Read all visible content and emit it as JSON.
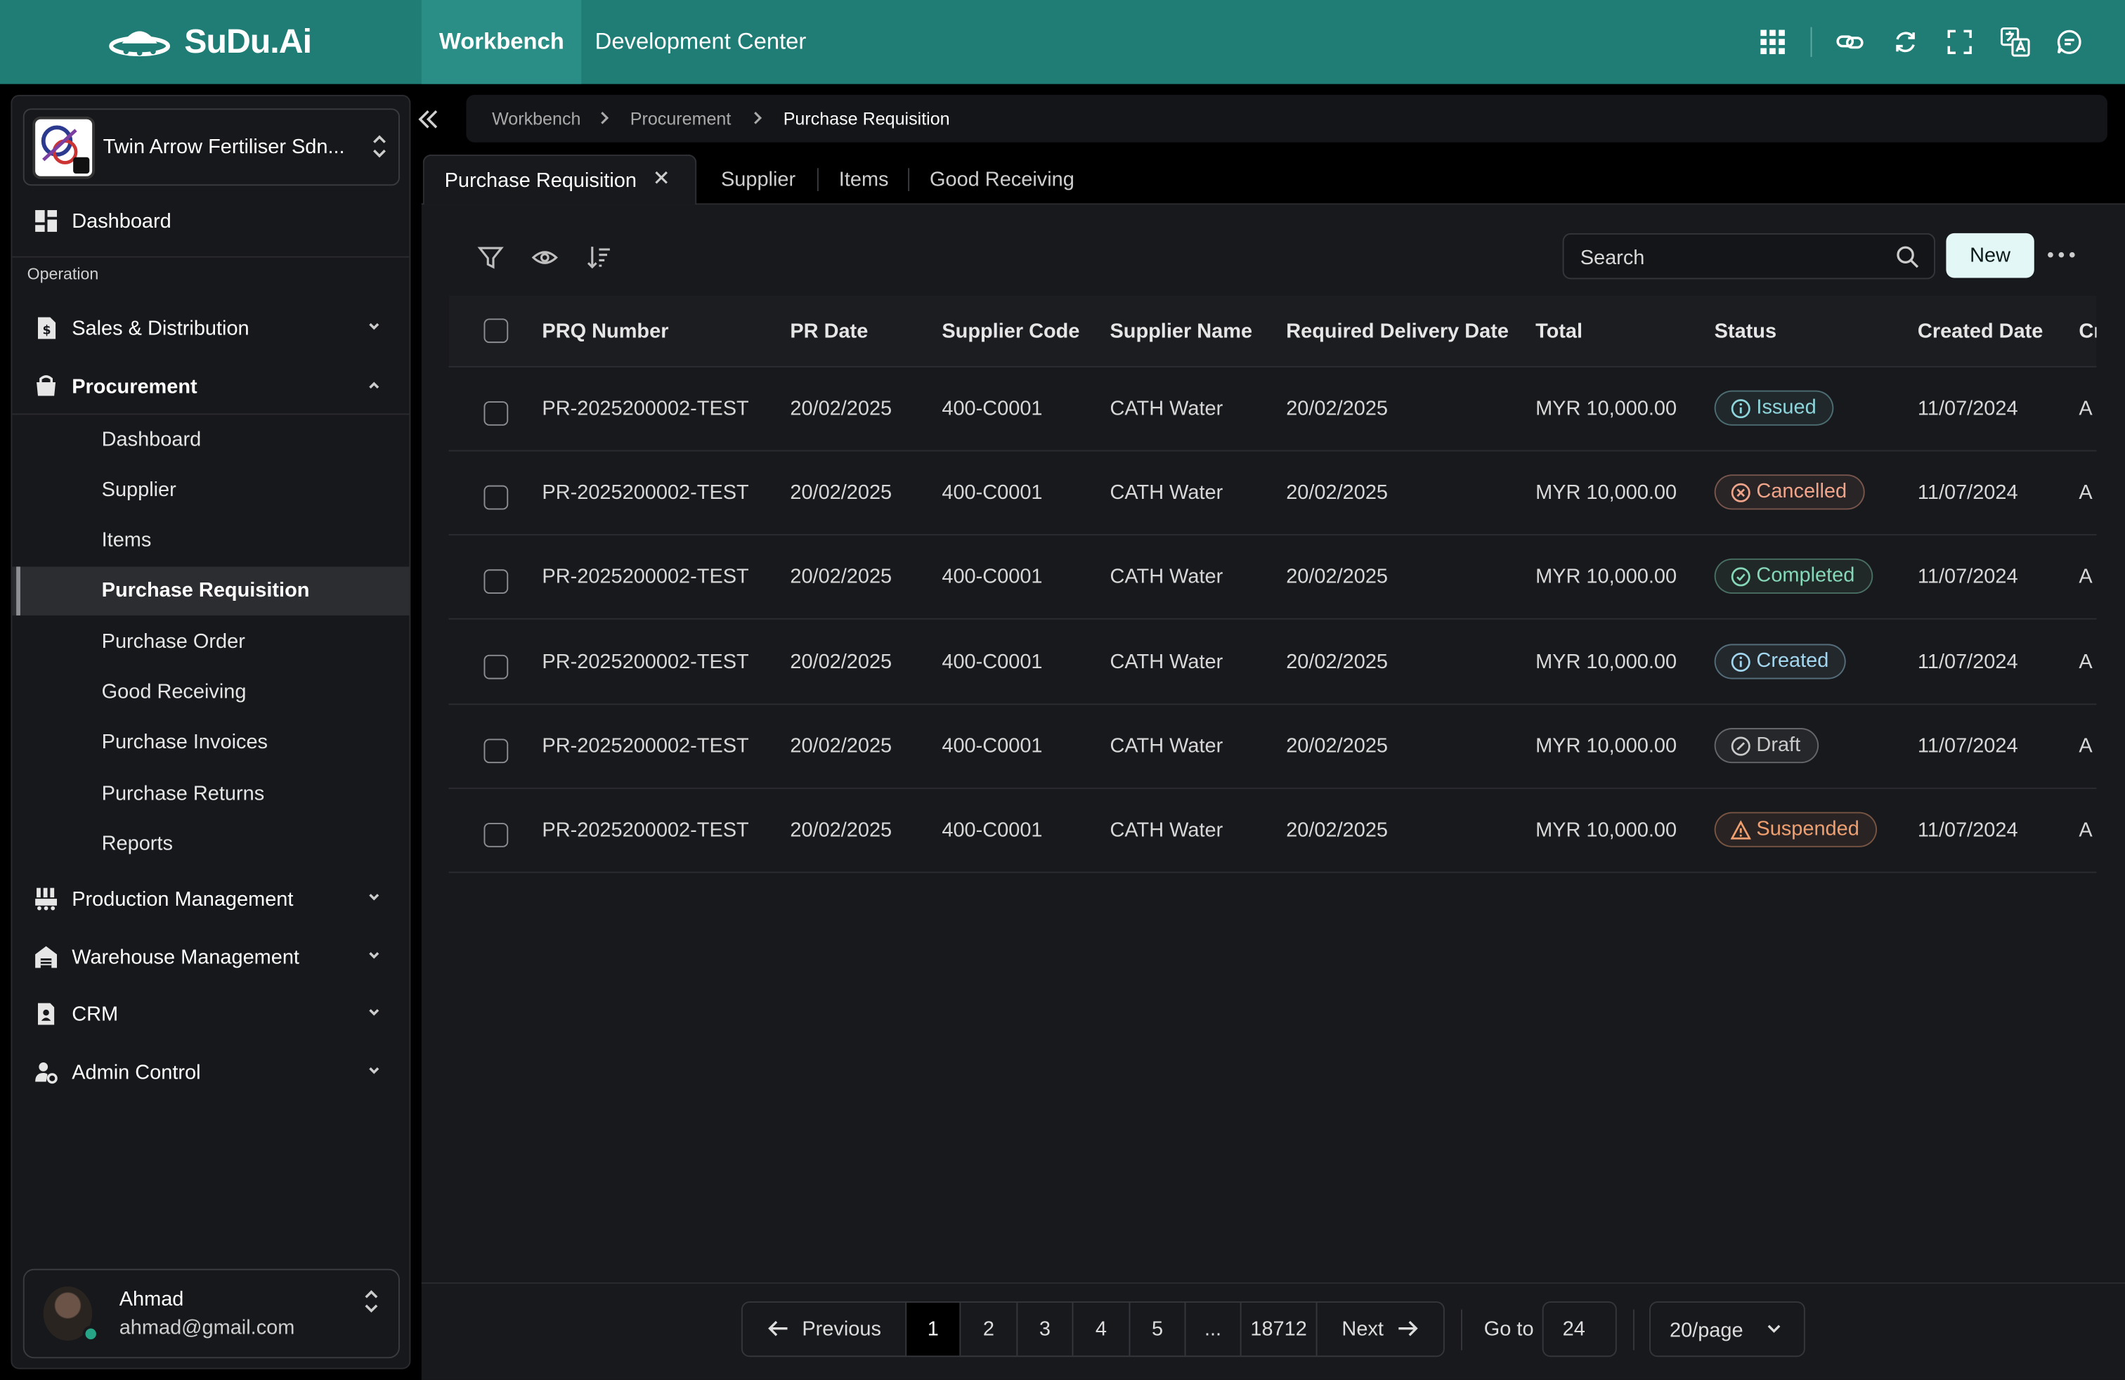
{
  "app": {
    "brand": "SuDu.Ai",
    "nav_tabs": [
      "Workbench",
      "Development Center"
    ]
  },
  "sidebar": {
    "org_name": "Twin Arrow Fertiliser Sdn...",
    "dashboard": "Dashboard",
    "section_label": "Operation",
    "modules": [
      {
        "label": "Sales & Distribution",
        "icon": "invoice-icon"
      },
      {
        "label": "Procurement",
        "icon": "bag-icon"
      },
      {
        "label": "Production Management",
        "icon": "factory-icon"
      },
      {
        "label": "Warehouse Management",
        "icon": "warehouse-icon"
      },
      {
        "label": "CRM",
        "icon": "contact-icon"
      },
      {
        "label": "Admin Control",
        "icon": "user-gear-icon"
      }
    ],
    "procurement_items": [
      "Dashboard",
      "Supplier",
      "Items",
      "Purchase Requisition",
      "Purchase Order",
      "Good Receiving",
      "Purchase Invoices",
      "Purchase Returns",
      "Reports"
    ],
    "user": {
      "name": "Ahmad",
      "email": "ahmad@gmail.com"
    }
  },
  "breadcrumb": [
    "Workbench",
    "Procurement",
    "Purchase Requisition"
  ],
  "tabs": [
    "Purchase Requisition",
    "Supplier",
    "Items",
    "Good Receiving"
  ],
  "toolbar": {
    "search_placeholder": "Search",
    "new_label": "New"
  },
  "table": {
    "columns": [
      "PRQ Number",
      "PR Date",
      "Supplier Code",
      "Supplier Name",
      "Required Delivery Date",
      "Total",
      "Status",
      "Created Date",
      "Cr"
    ],
    "rows": [
      {
        "prq": "PR-2025200002-TEST",
        "pr_date": "20/02/2025",
        "code": "400-C0001",
        "name": "CATH Water",
        "delivery": "20/02/2025",
        "total": "MYR 10,000.00",
        "status": "Issued",
        "created": "11/07/2024",
        "cr": "A"
      },
      {
        "prq": "PR-2025200002-TEST",
        "pr_date": "20/02/2025",
        "code": "400-C0001",
        "name": "CATH Water",
        "delivery": "20/02/2025",
        "total": "MYR 10,000.00",
        "status": "Cancelled",
        "created": "11/07/2024",
        "cr": "A"
      },
      {
        "prq": "PR-2025200002-TEST",
        "pr_date": "20/02/2025",
        "code": "400-C0001",
        "name": "CATH Water",
        "delivery": "20/02/2025",
        "total": "MYR 10,000.00",
        "status": "Completed",
        "created": "11/07/2024",
        "cr": "A"
      },
      {
        "prq": "PR-2025200002-TEST",
        "pr_date": "20/02/2025",
        "code": "400-C0001",
        "name": "CATH Water",
        "delivery": "20/02/2025",
        "total": "MYR 10,000.00",
        "status": "Created",
        "created": "11/07/2024",
        "cr": "A"
      },
      {
        "prq": "PR-2025200002-TEST",
        "pr_date": "20/02/2025",
        "code": "400-C0001",
        "name": "CATH Water",
        "delivery": "20/02/2025",
        "total": "MYR 10,000.00",
        "status": "Draft",
        "created": "11/07/2024",
        "cr": "A"
      },
      {
        "prq": "PR-2025200002-TEST",
        "pr_date": "20/02/2025",
        "code": "400-C0001",
        "name": "CATH Water",
        "delivery": "20/02/2025",
        "total": "MYR 10,000.00",
        "status": "Suspended",
        "created": "11/07/2024",
        "cr": "A"
      }
    ],
    "status_colors": {
      "Issued": "#8fd6dc",
      "Cancelled": "#f0a58a",
      "Completed": "#86d9b8",
      "Created": "#a3d7f0",
      "Draft": "#c9c9c9",
      "Suspended": "#f0a070"
    }
  },
  "pagination": {
    "previous_label": "Previous",
    "next_label": "Next",
    "pages": [
      "1",
      "2",
      "3",
      "4",
      "5",
      "...",
      "18712"
    ],
    "current_page": "1",
    "goto_label": "Go to",
    "goto_value": "24",
    "page_size": "20/page"
  },
  "colors": {
    "brand_teal": "#1f7d76",
    "new_button": "#e3f8f6"
  }
}
